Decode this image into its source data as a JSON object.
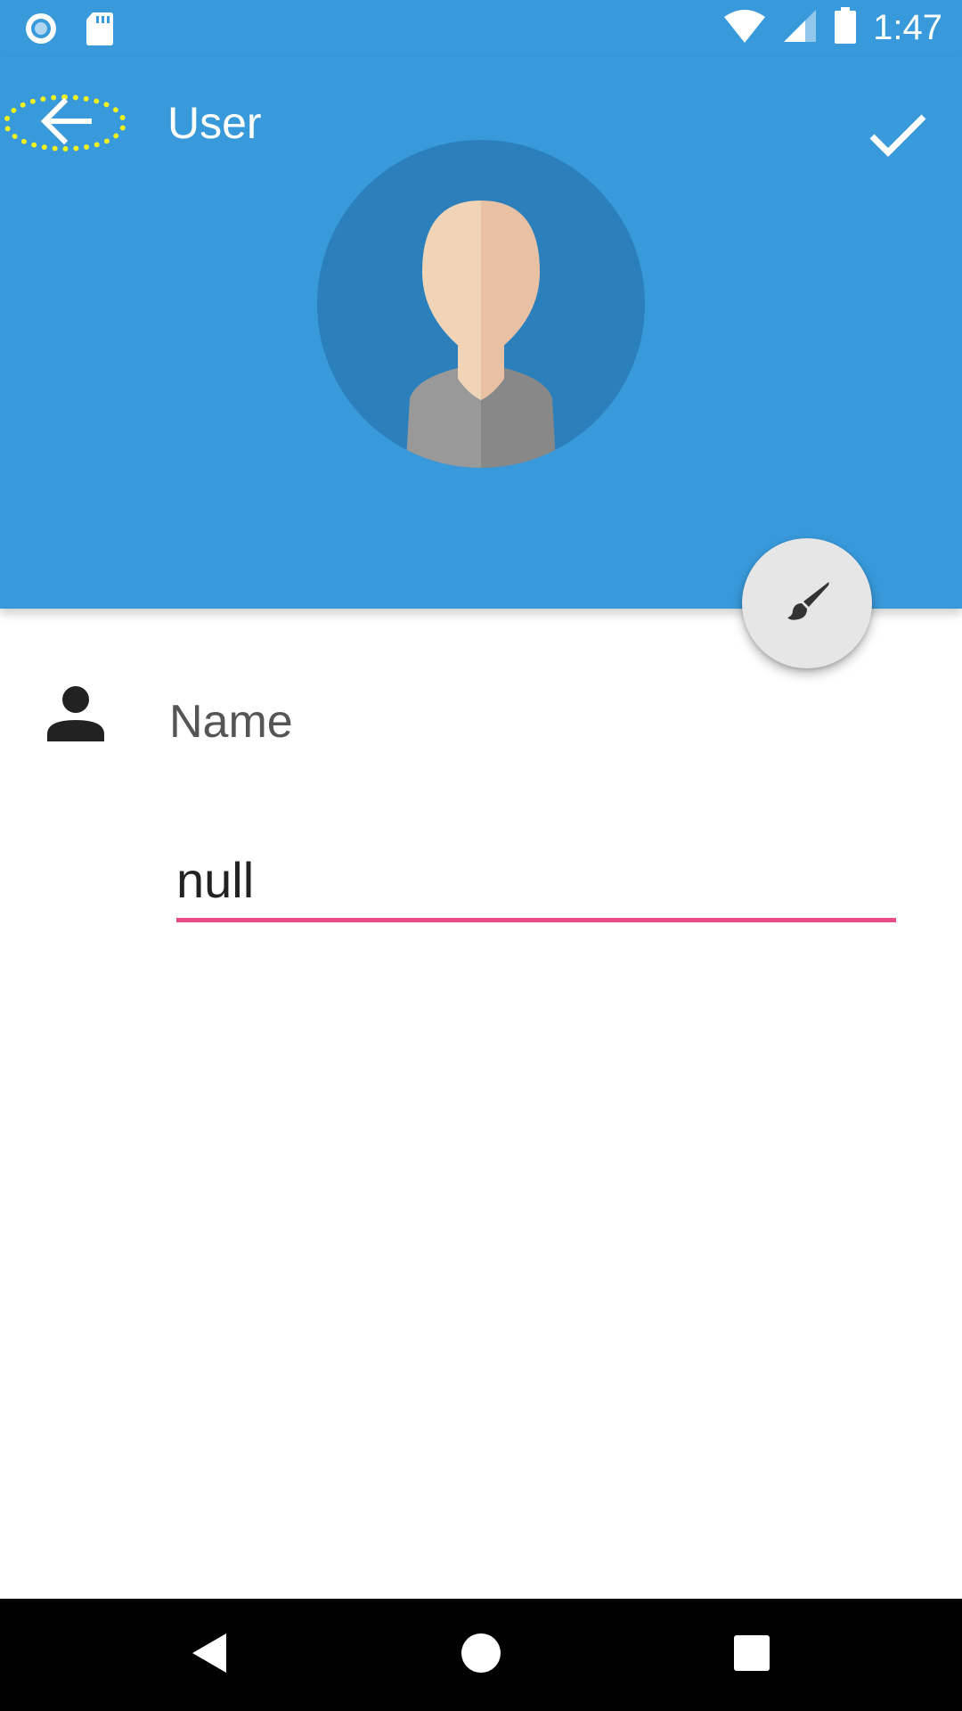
{
  "status_bar": {
    "time": "1:47",
    "icons": [
      "recording-icon",
      "sd-card-icon",
      "wifi-icon",
      "signal-icon",
      "battery-icon"
    ]
  },
  "toolbar": {
    "title": "User",
    "back_icon": "arrow-back-icon",
    "confirm_icon": "check-icon"
  },
  "profile": {
    "avatar": "default-user-avatar",
    "edit_icon": "paintbrush-icon"
  },
  "form": {
    "name_icon": "person-icon",
    "name_label": "Name",
    "name_value": "null"
  },
  "navigation_bar": {
    "icons": [
      "nav-back-icon",
      "nav-home-icon",
      "nav-recents-icon"
    ]
  },
  "colors": {
    "primary": "#3899DB",
    "avatar_circle": "#2B80BC",
    "accent_underline": "#E94B86",
    "focus_ring": "#F2F21C"
  }
}
